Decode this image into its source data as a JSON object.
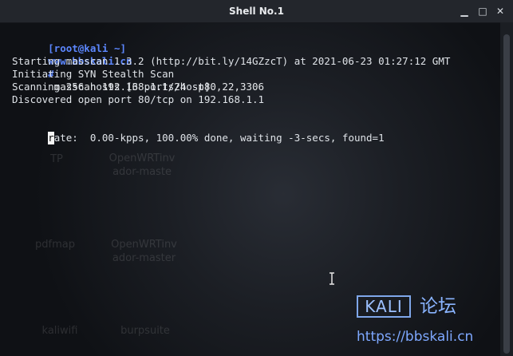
{
  "window": {
    "title": "Shell No.1",
    "controls": {
      "minimize": "▁",
      "maximize": "□",
      "close": "✕"
    }
  },
  "terminal": {
    "prompt_user": "[root@kali ~]",
    "prompt_host": "www.bbskali.cn",
    "prompt_symbol": "#",
    "command": " masscan 192.168.1.1/24 -p80,22,3306",
    "output": [
      "Starting masscan 1.3.2 (http://bit.ly/14GZzcT) at 2021-06-23 01:27:12 GMT",
      "Initiating SYN Stealth Scan",
      "Scanning 256 hosts [3 ports/host]",
      "Discovered open port 80/tcp on 192.168.1.1"
    ],
    "status_cursor_char": "r",
    "status_rest": "ate:  0.00-kpps, 100.00% done, waiting -3-secs, found=1"
  },
  "desktop_ghosts": [
    "TP",
    "OpenWRTinv\nador-maste",
    "pdfmap",
    "OpenWRTinv\nador-master",
    "kaliwifi",
    "burpsuite"
  ],
  "watermark": {
    "badge": "KALI",
    "forum": "论坛",
    "url": "https://bbskali.cn"
  },
  "colors": {
    "prompt": "#5c87ff",
    "text": "#dfe3e8",
    "watermark": "#8ab4ff"
  }
}
